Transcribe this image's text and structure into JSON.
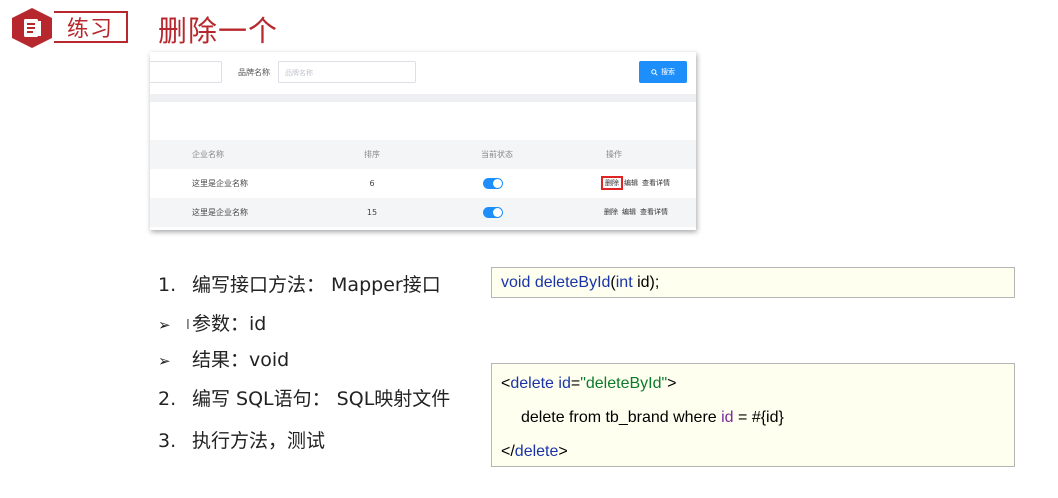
{
  "badge": {
    "label": "练习",
    "icon": "document-icon",
    "color": "#b7282e"
  },
  "title": "删除一个",
  "screenshot": {
    "filter_label": "品牌名称",
    "filter_placeholder": "品牌名称",
    "search_label": "搜索",
    "columns": [
      "企业名称",
      "排序",
      "当前状态",
      "操作"
    ],
    "rows": [
      {
        "name": "这里是企业名称",
        "sort": "6",
        "status_on": true,
        "ops": [
          "删除",
          "编辑",
          "查看详情"
        ]
      },
      {
        "name": "这里是企业名称",
        "sort": "15",
        "status_on": true,
        "ops": [
          "删除",
          "编辑",
          "查看详情"
        ]
      }
    ],
    "accent": "#1e8ffa",
    "highlight_color": "#e02424"
  },
  "steps": [
    {
      "marker": "1.",
      "text": "编写接口方法： Mapper接口"
    },
    {
      "marker": "➢",
      "text": "参数：id"
    },
    {
      "marker": "➢",
      "text": "结果：void"
    },
    {
      "marker": "2.",
      "text": "编写 SQL语句： SQL映射文件"
    },
    {
      "marker": "3.",
      "text": "执行方法，测试"
    }
  ],
  "code1": {
    "kw": "void",
    "method": "deleteById",
    "open": "(",
    "type": "int",
    "param": " id);"
  },
  "code2": {
    "line1_open": "<",
    "line1_tag": "delete",
    "line1_attr": " id",
    "line1_eq": "=",
    "line1_val": "\"deleteById\"",
    "line1_close": ">",
    "line2_pre": "delete from tb_brand where ",
    "line2_id": "id",
    "line2_post": " = #{id}",
    "line3_open": "</",
    "line3_tag": "delete",
    "line3_close": ">"
  }
}
